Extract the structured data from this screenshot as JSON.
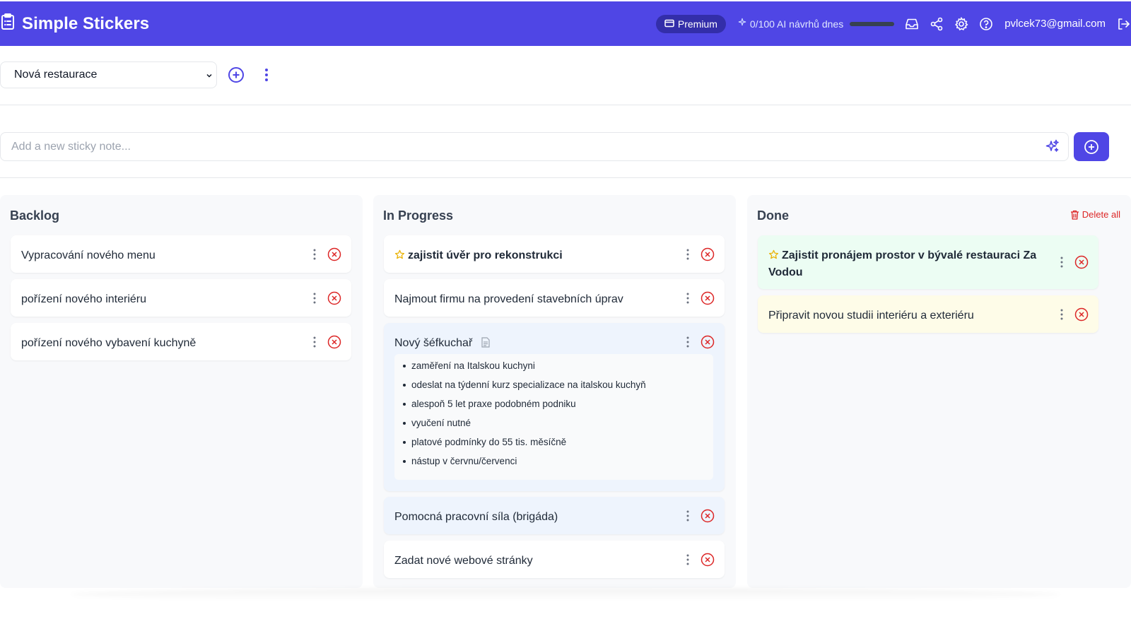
{
  "app": {
    "title": "Simple Stickers",
    "premium_label": "Premium",
    "ai_usage_label": "0/100 AI návrhů dnes",
    "ai_usage_fraction": 1.0,
    "user_email": "pvlcek73@gmail.com"
  },
  "board": {
    "selected": "Nová restaurace"
  },
  "note_input": {
    "placeholder": "Add a new sticky note...",
    "value": ""
  },
  "columns": [
    {
      "title": "Backlog",
      "cards": [
        {
          "text": "Vypracování nového menu"
        },
        {
          "text": "pořízení nového interiéru"
        },
        {
          "text": "pořízení nového vybavení kuchyně"
        }
      ]
    },
    {
      "title": "In Progress",
      "cards": [
        {
          "text": "zajistit úvěr pro rekonstrukci",
          "starred": true
        },
        {
          "text": "Najmout firmu na provedení stavebních úprav"
        },
        {
          "text": "Nový šéfkuchař",
          "has_note": true,
          "details": [
            "zaměření na Italskou kuchyni",
            "odeslat na týdenní kurz specializace na italskou kuchyň",
            "alespoň 5 let praxe podobném podniku",
            "vyučení nutné",
            "platové podmínky do 55 tis. měsíčně",
            "nástup v červnu/červenci"
          ]
        },
        {
          "text": "Pomocná pracovní síla (brigáda)"
        },
        {
          "text": "Zadat nové webové stránky"
        }
      ]
    },
    {
      "title": "Done",
      "delete_all_label": "Delete all",
      "cards": [
        {
          "text": "Zajistit pronájem prostor v bývalé restauraci Za Vodou",
          "starred": true
        },
        {
          "text": "Připravit novou studii interiéru a exteriéru"
        }
      ]
    }
  ],
  "colors": {
    "brand": "#4f46e5",
    "danger": "#dc2626",
    "star": "#eab308",
    "card_green": "#ecfdf3",
    "card_yellow": "#fefce8",
    "card_blue": "#eef4fd"
  },
  "icons": [
    "clipboard-icon",
    "credit-card-icon",
    "sparkles-icon",
    "inbox-icon",
    "share-icon",
    "gear-icon",
    "help-icon",
    "logout-icon",
    "chevron-down-icon",
    "plus-circle-icon",
    "kebab-icon",
    "close-circle-icon",
    "star-icon",
    "note-icon",
    "trash-icon"
  ]
}
